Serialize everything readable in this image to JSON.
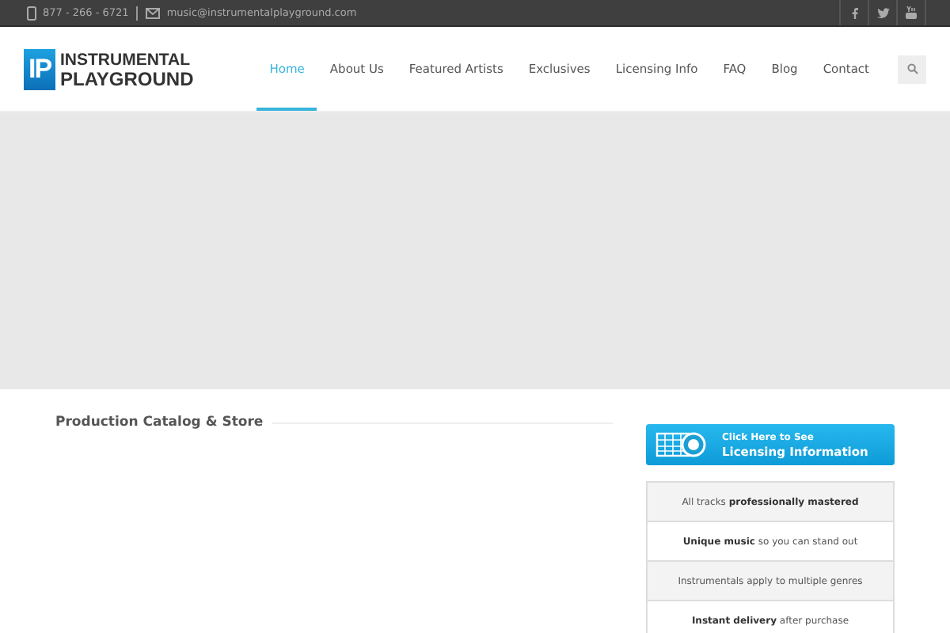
{
  "top_bar": {
    "phone": "877 - 266 - 6721",
    "email": "music@instrumentalplayground.com",
    "social": [
      {
        "kind": "facebook"
      },
      {
        "kind": "twitter"
      },
      {
        "kind": "youtube"
      }
    ]
  },
  "logo": {
    "mark": "IP",
    "line1": "INSTRUMENTAL",
    "line2": "PLAYGROUND"
  },
  "nav": [
    {
      "label": "Home",
      "selected": true
    },
    {
      "label": "About Us",
      "selected": false
    },
    {
      "label": "Featured Artists",
      "selected": false
    },
    {
      "label": "Exclusives",
      "selected": false
    },
    {
      "label": "Licensing Info",
      "selected": false
    },
    {
      "label": "FAQ",
      "selected": false
    },
    {
      "label": "Blog",
      "selected": false
    },
    {
      "label": "Contact",
      "selected": false
    }
  ],
  "section_title": "Production Catalog & Store",
  "licensing_banner": {
    "line1": "Click Here to See",
    "line2": "Licensing Information"
  },
  "features": [
    "All tracks **professionally mastered**",
    "**Unique music** so you can stand out",
    "Instrumentals apply to multiple genres",
    "**Instant delivery** after purchase"
  ]
}
